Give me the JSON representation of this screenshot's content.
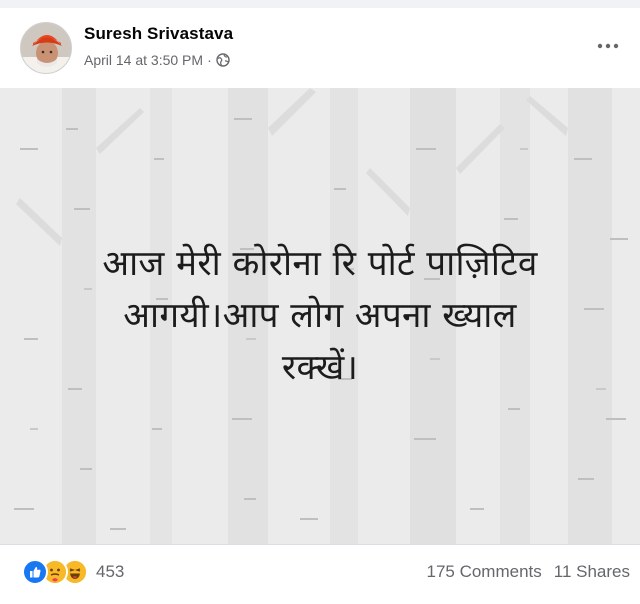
{
  "post": {
    "author": "Suresh Srivastava",
    "timestamp": "April 14 at 3:50 PM",
    "separator": "·",
    "privacy_icon": "globe-icon",
    "more_icon": "more-options-icon",
    "text_lines": [
      "आज मेरी कोरोना रि पोर्ट पाज़िटिव",
      "आगयी।आप लोग अपना ख्याल",
      "रक्खें।"
    ],
    "background_theme": "birch-forest"
  },
  "footer": {
    "reactions": [
      "like",
      "care",
      "haha"
    ],
    "reaction_count": "453",
    "comments": "175 Comments",
    "shares": "11 Shares"
  },
  "colors": {
    "like_blue": "#1877f2",
    "emoji_yellow": "#f7b928",
    "care_heart": "#f33e58",
    "meta_gray": "#65676b",
    "post_bg": "#ececec"
  }
}
